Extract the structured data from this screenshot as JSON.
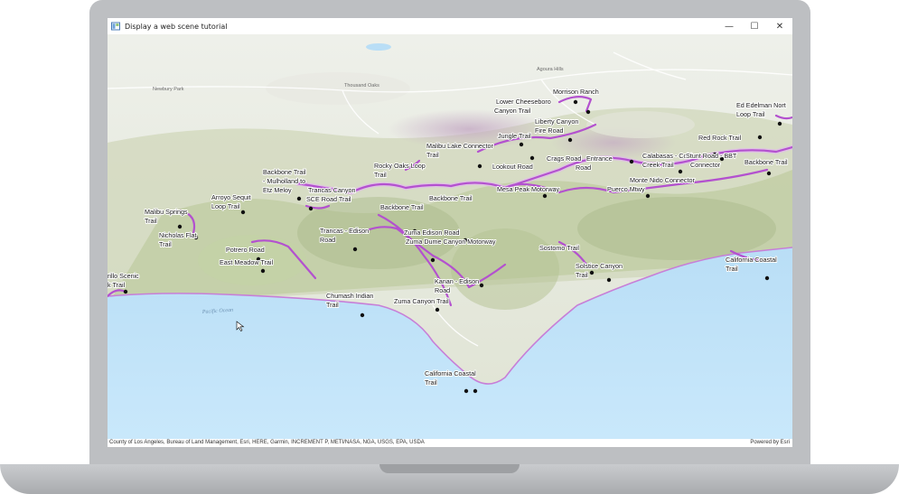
{
  "window": {
    "title": "Display a web scene tutorial",
    "minimize_glyph": "—",
    "maximize_glyph": "☐",
    "close_glyph": "✕"
  },
  "map": {
    "ocean_label": "Pacific Ocean",
    "trail_labels": [
      {
        "id": "morrison-ranch",
        "lines": [
          "Morrison Ranch"
        ]
      },
      {
        "id": "lower-cheeseboro",
        "lines": [
          "Lower Cheeseboro",
          "Canyon Trail"
        ]
      },
      {
        "id": "liberty-canyon",
        "lines": [
          "Liberty Canyon",
          "Fire Road"
        ]
      },
      {
        "id": "ed-edelman",
        "lines": [
          "Ed Edelman Nort",
          "Loop Trail"
        ]
      },
      {
        "id": "red-rock",
        "lines": [
          "Red Rock Trail"
        ]
      },
      {
        "id": "jungle-trail",
        "lines": [
          "Jungle Trail"
        ]
      },
      {
        "id": "malibu-lake",
        "lines": [
          "Malibu Lake Connector",
          "Trail"
        ]
      },
      {
        "id": "crags-road",
        "lines": [
          "Crags Road",
          "Entrance",
          "Road"
        ]
      },
      {
        "id": "calabasas-cold",
        "lines": [
          "Calabasas - Cold",
          "Creek Trail"
        ]
      },
      {
        "id": "stunt-road",
        "lines": [
          "Stunt Road - BBT",
          "Connector"
        ]
      },
      {
        "id": "backbone-east",
        "lines": [
          "Backbone Trail"
        ]
      },
      {
        "id": "lookout-road",
        "lines": [
          "Lookout Road"
        ]
      },
      {
        "id": "rocky-oaks",
        "lines": [
          "Rocky Oaks Loop",
          "Trail"
        ]
      },
      {
        "id": "backbone-mulholland",
        "lines": [
          "Backbone Trail",
          "- Mulholland to",
          "Etz Meloy"
        ]
      },
      {
        "id": "trancas-canyon",
        "lines": [
          "Trancas Canyon",
          "SCE Road Trail"
        ]
      },
      {
        "id": "mesa-peak",
        "lines": [
          "Mesa Peak Motorway"
        ]
      },
      {
        "id": "puerco-mtwy",
        "lines": [
          "Puerco Mtwy"
        ]
      },
      {
        "id": "monte-nido",
        "lines": [
          "Monte Nido Connector"
        ]
      },
      {
        "id": "arroyo-sequit",
        "lines": [
          "Arroyo Sequit",
          "Loop Trail"
        ]
      },
      {
        "id": "backbone-mid",
        "lines": [
          "Backbone Trail"
        ]
      },
      {
        "id": "backbone-west",
        "lines": [
          "Backbone Trail"
        ]
      },
      {
        "id": "malibu-springs",
        "lines": [
          "Malibu Springs",
          "Trail"
        ]
      },
      {
        "id": "trancas-edison",
        "lines": [
          "Trancas - Edison",
          "Road"
        ]
      },
      {
        "id": "zuma-edison",
        "lines": [
          "Zuma Edison Road"
        ]
      },
      {
        "id": "zuma-dume",
        "lines": [
          "Zuma Dume Canyon Motorway"
        ]
      },
      {
        "id": "nicholas-flat",
        "lines": [
          "Nicholas Flat",
          "Trail"
        ]
      },
      {
        "id": "potrero-road",
        "lines": [
          "Potrero Road"
        ]
      },
      {
        "id": "sostomo",
        "lines": [
          "Sostomo Trail"
        ]
      },
      {
        "id": "east-meadow",
        "lines": [
          "East Meadow Trail"
        ]
      },
      {
        "id": "solstice-canyon",
        "lines": [
          "Solstice Canyon",
          "Trail"
        ]
      },
      {
        "id": "california-coastal-east",
        "lines": [
          "California Coastal",
          "Trail"
        ]
      },
      {
        "id": "carillo-scenic",
        "lines": [
          "rillo Scenic",
          "k Trail"
        ]
      },
      {
        "id": "kanan-edison",
        "lines": [
          "Kanan - Edison",
          "Road"
        ]
      },
      {
        "id": "chumash-indian",
        "lines": [
          "Chumash Indian",
          "Trail"
        ]
      },
      {
        "id": "zuma-canyon",
        "lines": [
          "Zuma Canyon Trail"
        ]
      },
      {
        "id": "california-coastal-south",
        "lines": [
          "California Coastal",
          "Trail"
        ]
      }
    ]
  },
  "attribution": {
    "sources": "County of Los Angeles, Bureau of Land Management, Esri, HERE, Garmin, INCREMENT P, METI/NASA, NGA, USGS, EPA, USDA",
    "powered_by": "Powered by Esri"
  },
  "colors": {
    "trail": "#b351cf",
    "ocean": "#bfe3fa",
    "land": "#d9ddc8",
    "vegetation": "#b9c99a"
  }
}
